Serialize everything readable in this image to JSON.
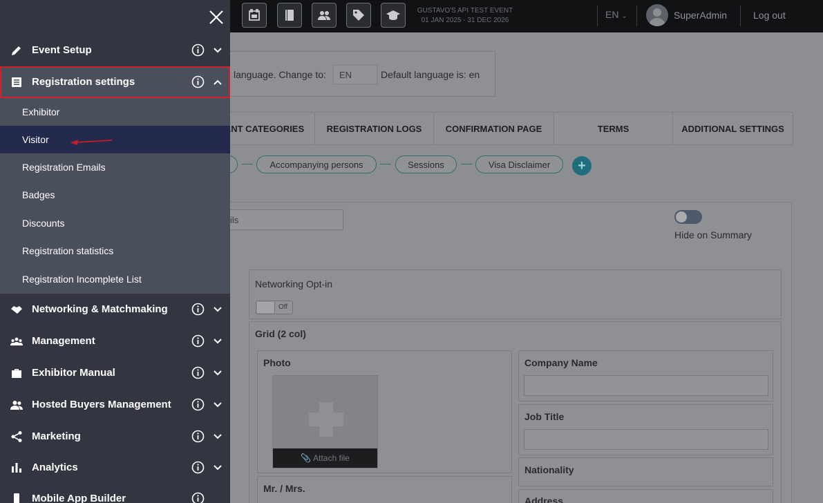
{
  "topbar": {
    "event_name": "GUSTAVO'S API TEST EVENT",
    "event_dates": "01 JAN 2025 - 31 DEC 2026",
    "language": "EN",
    "username": "SuperAdmin",
    "logout": "Log out",
    "icons": [
      "calendar-icon",
      "book-icon",
      "users-icon",
      "tag-icon",
      "graduation-cap-icon"
    ]
  },
  "content": {
    "lang_change_text": "language. Change to:",
    "lang_input_value": "EN",
    "lang_default_text": "Default language is: en",
    "tabs": [
      "ANT CATEGORIES",
      "REGISTRATION LOGS",
      "CONFIRMATION PAGE",
      "TERMS",
      "ADDITIONAL SETTINGS"
    ],
    "steps": [
      "Accompanying persons",
      "Sessions",
      "Visa Disclaimer"
    ],
    "add_step": "+",
    "field_input_value": "ils",
    "hide_on_summary": "Hide on Summary",
    "networking_optin": "Networking Opt-in",
    "off_label": "Off",
    "grid_title": "Grid (2 col)",
    "photo_label": "Photo",
    "attach_file": "Attach file",
    "mr_mrs": "Mr. / Mrs.",
    "company_name": "Company Name",
    "job_title": "Job Title",
    "nationality": "Nationality",
    "address": "Address"
  },
  "sidebar": {
    "items": [
      {
        "label": "Event Setup",
        "icon": "pencil-icon",
        "expanded": false
      },
      {
        "label": "Registration settings",
        "icon": "list-icon",
        "expanded": true
      },
      {
        "label": "Networking & Matchmaking",
        "icon": "handshake-icon",
        "expanded": false
      },
      {
        "label": "Management",
        "icon": "people-group-icon",
        "expanded": false
      },
      {
        "label": "Exhibitor Manual",
        "icon": "briefcase-icon",
        "expanded": false
      },
      {
        "label": "Hosted Buyers Management",
        "icon": "user-group-icon",
        "expanded": false
      },
      {
        "label": "Marketing",
        "icon": "share-icon",
        "expanded": false
      },
      {
        "label": "Analytics",
        "icon": "bar-chart-icon",
        "expanded": false
      },
      {
        "label": "Mobile App Builder",
        "icon": "mobile-icon",
        "expanded": false
      }
    ],
    "subitems": [
      "Exhibitor",
      "Visitor",
      "Registration Emails",
      "Badges",
      "Discounts",
      "Registration statistics",
      "Registration Incomplete List"
    ],
    "selected_subitem": "Visitor"
  },
  "colors": {
    "sidebar_bg": "#333640",
    "subpanel_bg": "#4a4f5c",
    "selected_bg": "#242a4e",
    "highlight_border": "#d0202c",
    "arrow": "#c0202a",
    "teal": "#1f6e7d"
  }
}
